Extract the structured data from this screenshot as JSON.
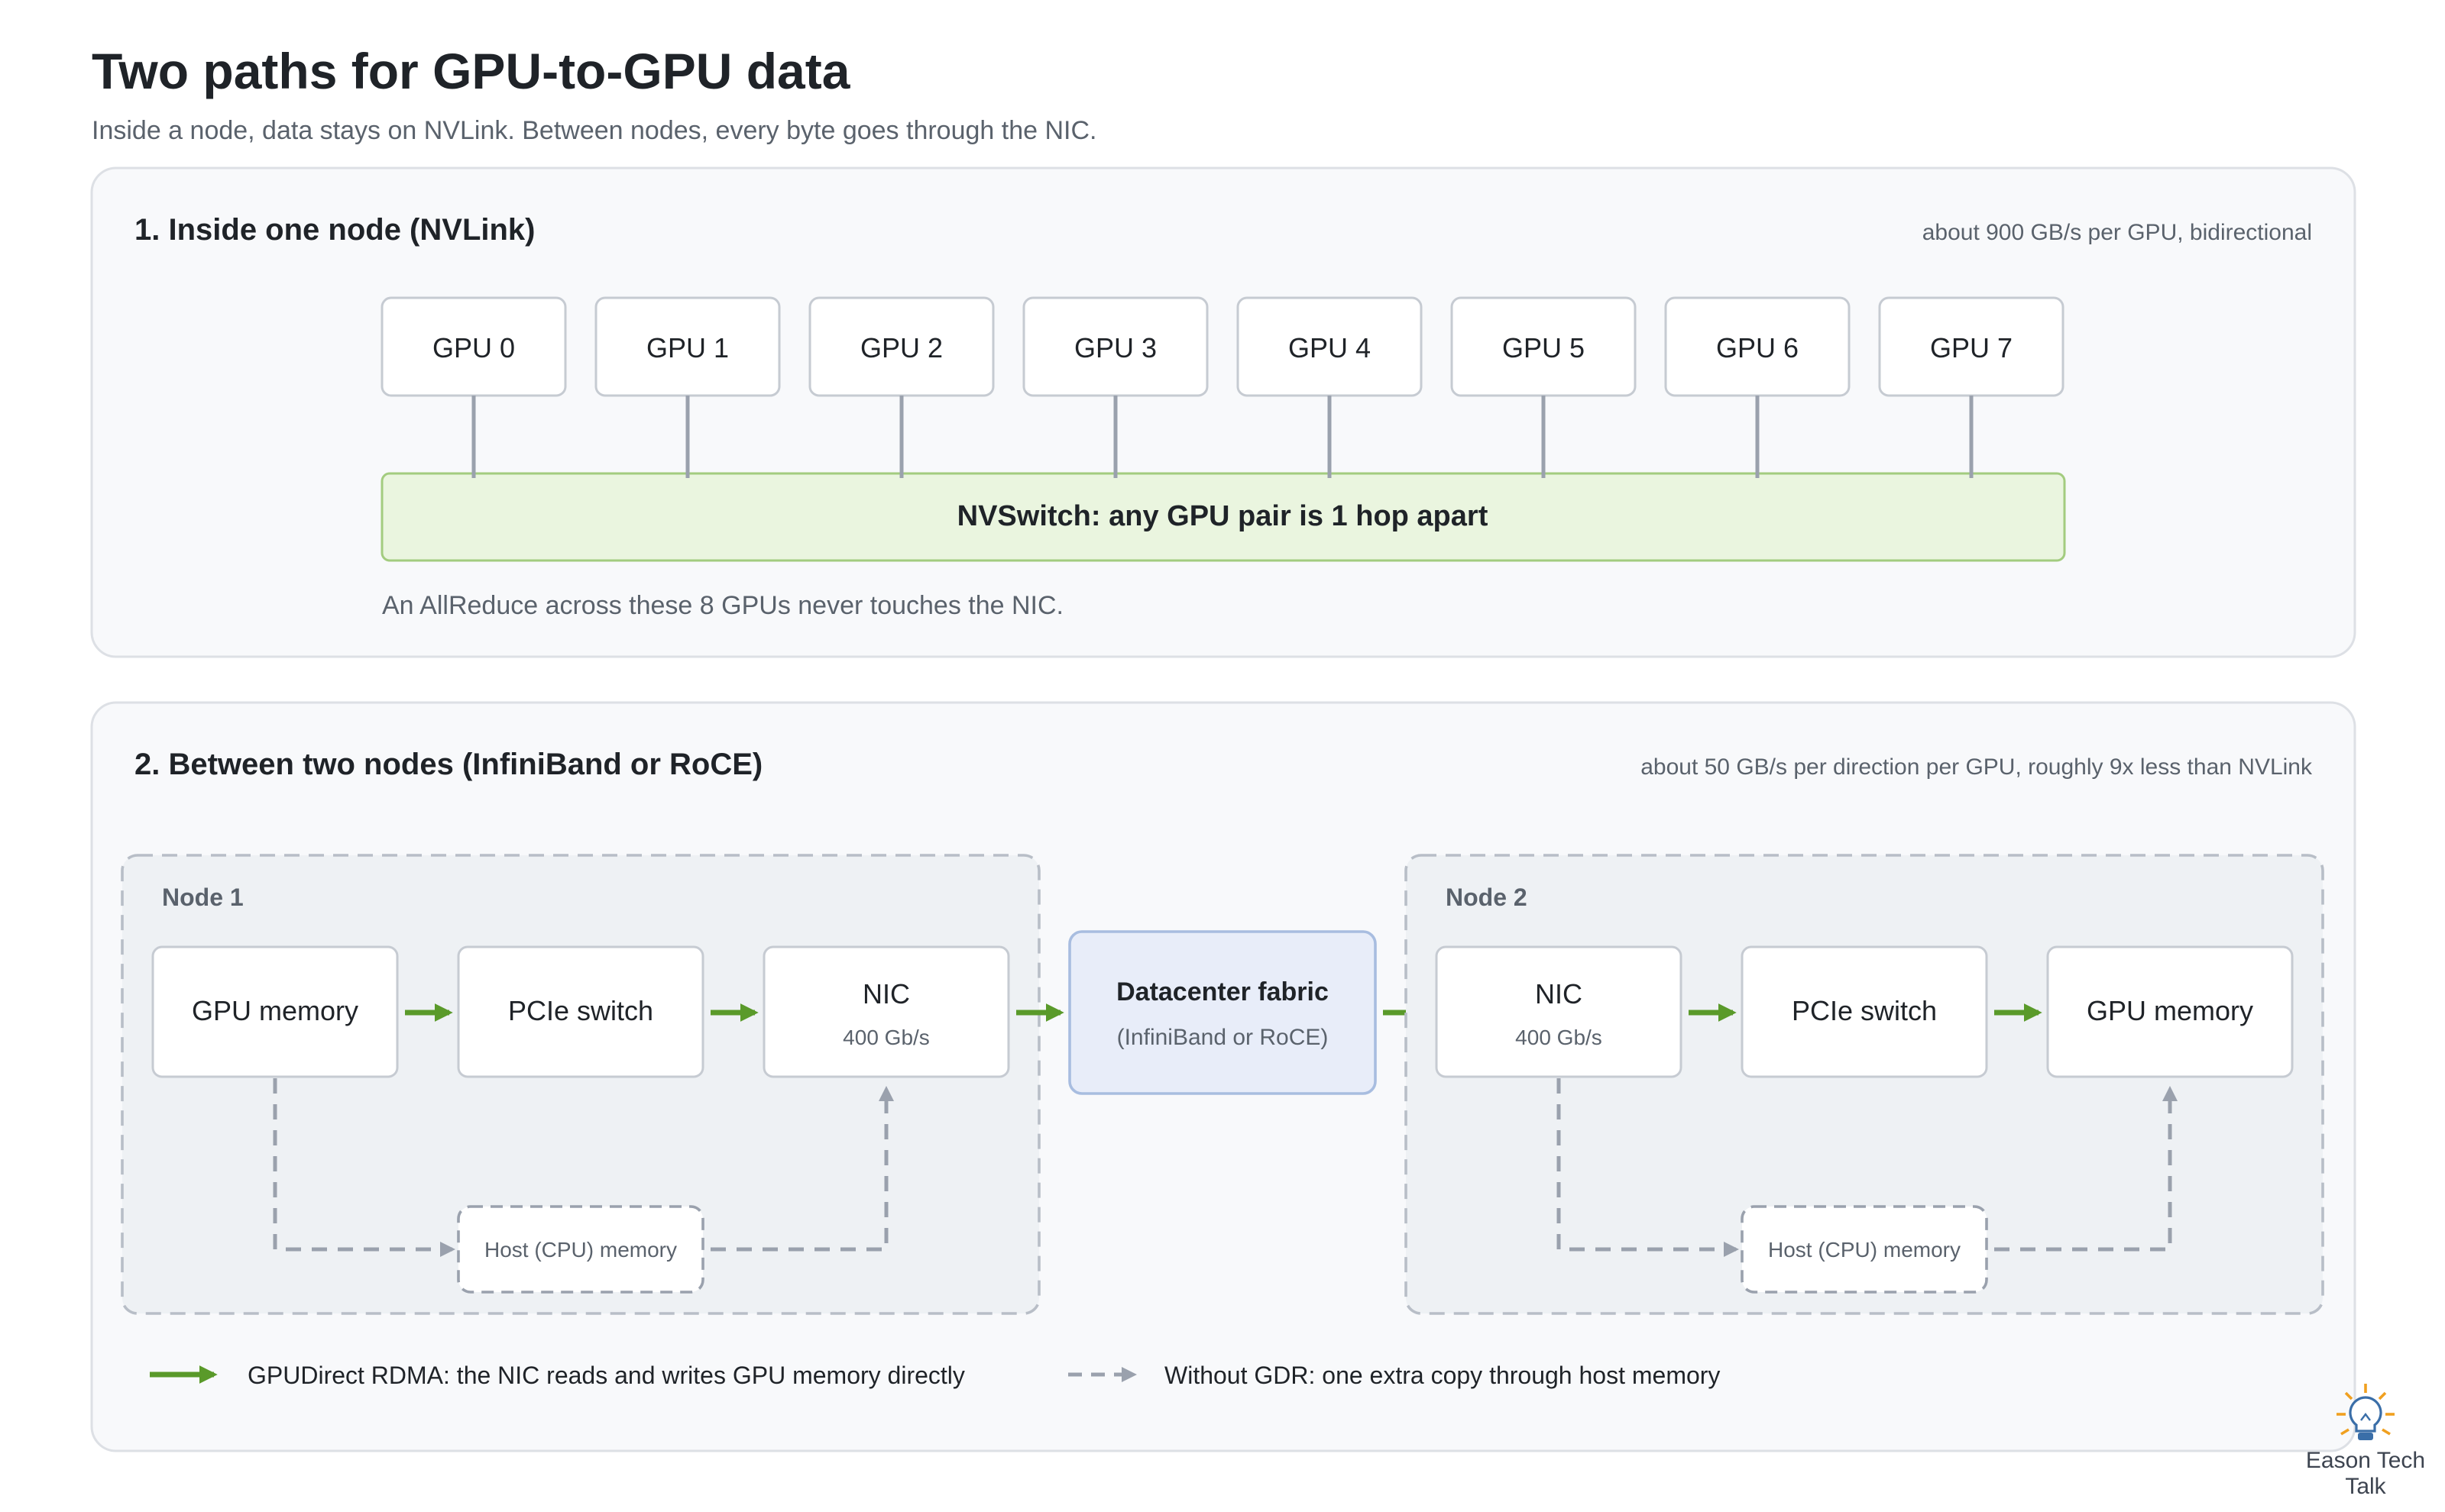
{
  "header": {
    "title": "Two paths for GPU-to-GPU data",
    "subtitle": "Inside a node, data stays on NVLink. Between nodes, every byte goes through the NIC."
  },
  "panel1": {
    "title": "1. Inside one node (NVLink)",
    "bandwidth": "about 900 GB/s per GPU, bidirectional",
    "gpus": [
      "GPU 0",
      "GPU 1",
      "GPU 2",
      "GPU 3",
      "GPU 4",
      "GPU 5",
      "GPU 6",
      "GPU 7"
    ],
    "switch_label": "NVSwitch: any GPU pair is 1 hop apart",
    "note": "An AllReduce across these 8 GPUs never touches the NIC."
  },
  "panel2": {
    "title": "2. Between two nodes (InfiniBand or RoCE)",
    "bandwidth": "about 50 GB/s per direction per GPU, roughly 9x less than NVLink",
    "node1": {
      "label": "Node 1",
      "gpu_memory": "GPU memory",
      "pcie_switch": "PCIe switch",
      "nic": "NIC",
      "nic_speed": "400 Gb/s",
      "host_memory": "Host (CPU) memory"
    },
    "fabric": {
      "label": "Datacenter fabric",
      "sublabel": "(InfiniBand or RoCE)"
    },
    "node2": {
      "label": "Node 2",
      "nic": "NIC",
      "nic_speed": "400 Gb/s",
      "pcie_switch": "PCIe switch",
      "gpu_memory": "GPU memory",
      "host_memory": "Host (CPU) memory"
    },
    "legend": {
      "gdr": "GPUDirect RDMA: the NIC reads and writes GPU memory directly",
      "no_gdr": "Without GDR: one extra copy through host memory"
    }
  },
  "logo": {
    "line1": "Eason Tech",
    "line2": "Talk"
  },
  "colors": {
    "green_arrow": "#5a9a2a",
    "gray_dash": "#9aa1ad",
    "switch_fill": "#eaf5df",
    "switch_stroke": "#a3cc7f",
    "fabric_fill": "#e8edf9",
    "fabric_stroke": "#a8bde0",
    "logo_orange": "#f0a020"
  }
}
